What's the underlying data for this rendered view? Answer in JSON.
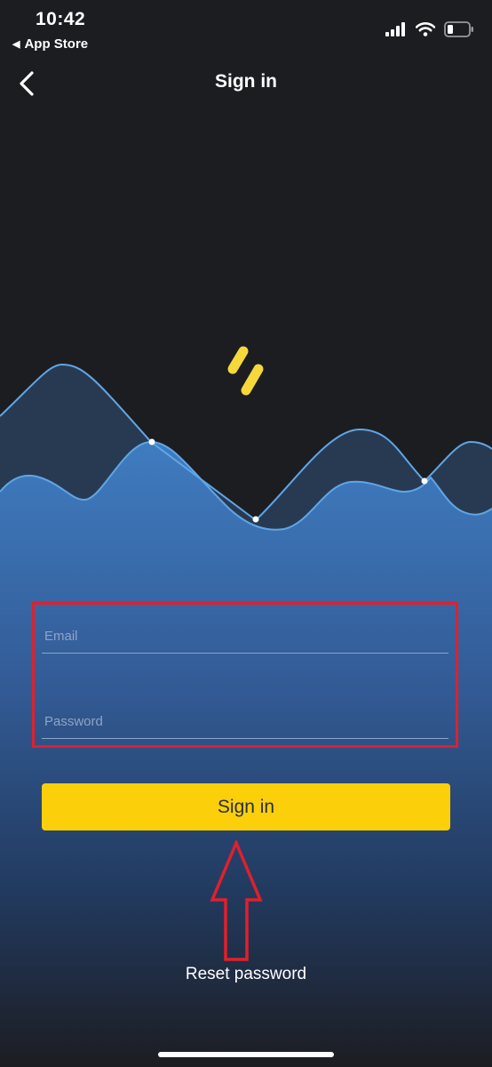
{
  "status_bar": {
    "time": "10:42",
    "back_app": "App Store",
    "icons": [
      "signal-icon",
      "wifi-icon",
      "battery-icon"
    ]
  },
  "nav": {
    "title": "Sign in",
    "back_icon": "chevron-left-icon"
  },
  "form": {
    "email": {
      "placeholder": "Email",
      "value": ""
    },
    "password": {
      "placeholder": "Password",
      "value": ""
    }
  },
  "signin_button": {
    "label": "Sign in"
  },
  "reset_link": {
    "label": "Reset password"
  },
  "colors": {
    "background": "#1c1d21",
    "accent_yellow": "#fbcf0a",
    "wave_blue": "#3e78ba",
    "wave_line": "#5fa6e6",
    "highlight_red": "#e0202c"
  }
}
